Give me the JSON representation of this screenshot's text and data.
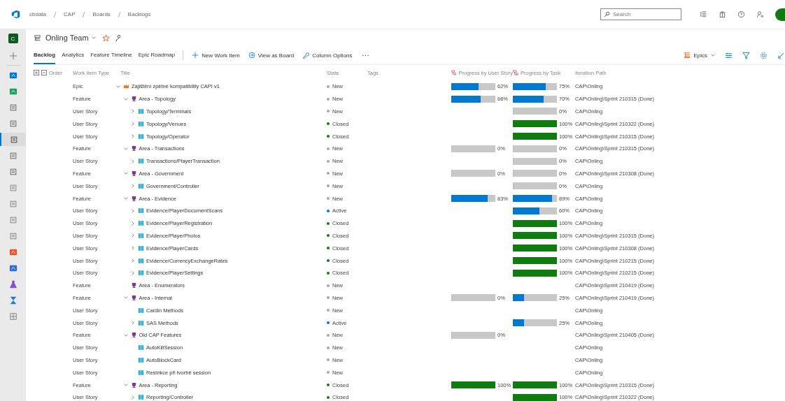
{
  "breadcrumbs": [
    "cbdata",
    "CAP",
    "Boards",
    "Backlogs"
  ],
  "search": {
    "placeholder": "Search"
  },
  "sidebar": {
    "project_initial": "C",
    "items": [
      {
        "kind": "add",
        "selected": false
      },
      {
        "kind": "overview",
        "selected": false
      },
      {
        "kind": "boards",
        "selected": false
      },
      {
        "kind": "workitems",
        "selected": false
      },
      {
        "kind": "board",
        "selected": false
      },
      {
        "kind": "backlog",
        "selected": true
      },
      {
        "kind": "sprints",
        "selected": false
      },
      {
        "kind": "queries",
        "selected": false
      },
      {
        "kind": "list",
        "selected": false
      },
      {
        "kind": "list",
        "selected": false
      },
      {
        "kind": "list",
        "selected": false
      },
      {
        "kind": "card",
        "selected": false
      },
      {
        "kind": "repos",
        "selected": false
      },
      {
        "kind": "pipelines",
        "selected": false
      },
      {
        "kind": "testplans",
        "selected": false
      },
      {
        "kind": "artifacts",
        "selected": false
      },
      {
        "kind": "grid",
        "selected": false
      }
    ]
  },
  "team": {
    "name": "Onling Team"
  },
  "tabs": [
    {
      "label": "Backlog",
      "selected": true
    },
    {
      "label": "Analytics",
      "selected": false
    },
    {
      "label": "Feature Timeline",
      "selected": false
    },
    {
      "label": "Epic Roadmap",
      "selected": false
    }
  ],
  "actions": [
    {
      "kind": "add",
      "label": "New Work Item"
    },
    {
      "kind": "board",
      "label": "View as Board"
    },
    {
      "kind": "wrench",
      "label": "Column Options"
    }
  ],
  "level_picker": {
    "label": "Epics"
  },
  "columns": [
    "Order",
    "Work Item Type",
    "Title",
    "State",
    "Tags",
    "Progress by User Story",
    "Progress by Task",
    "Iteration Path"
  ],
  "items": [
    {
      "kind": "epic",
      "type": "Epic",
      "title": "Zajištění zpětné kompatibility CAPI v1",
      "expanded": true,
      "state": {
        "label": "New",
        "color": "#a6a6a6"
      },
      "story_progress": {
        "level": 0.62,
        "reading": "62%"
      },
      "task_progress": {
        "level": 0.75,
        "reading": "75%"
      },
      "iteration": "CAP\\Onling",
      "children": [
        {
          "kind": "feature",
          "type": "Feature",
          "title": "Area - Topology",
          "expanded": true,
          "state": {
            "label": "New",
            "color": "#a6a6a6"
          },
          "story_progress": {
            "level": 0.66,
            "reading": "66%"
          },
          "task_progress": {
            "level": 0.7,
            "reading": "70%"
          },
          "iteration": "CAP\\Onling\\Sprint 210315 (Done)",
          "children": [
            {
              "kind": "story",
              "type": "User Story",
              "title": "Topology/Terminals",
              "expanded": false,
              "state": {
                "label": "New",
                "color": "#a6a6a6"
              },
              "task_progress": {
                "level": 0,
                "reading": "0%"
              },
              "iteration": "CAP\\Onling"
            },
            {
              "kind": "story",
              "type": "User Story",
              "title": "Topology/Venues",
              "expanded": false,
              "state": {
                "label": "Closed",
                "color": "#107c10"
              },
              "task_progress": {
                "level": 1,
                "reading": "100%"
              },
              "iteration": "CAP\\Onling\\Sprint 210322 (Done)"
            },
            {
              "kind": "story",
              "type": "User Story",
              "title": "Topology/Operator",
              "expanded": false,
              "state": {
                "label": "Closed",
                "color": "#107c10"
              },
              "task_progress": {
                "level": 1,
                "reading": "100%"
              },
              "iteration": "CAP\\Onling\\Sprint 210315 (Done)"
            }
          ]
        },
        {
          "kind": "feature",
          "type": "Feature",
          "title": "Area - Transactions",
          "expanded": true,
          "state": {
            "label": "New",
            "color": "#a6a6a6"
          },
          "story_progress": {
            "level": 0,
            "reading": "0%"
          },
          "task_progress": {
            "level": 0,
            "reading": "0%"
          },
          "iteration": "CAP\\Onling\\Sprint 210315 (Done)",
          "children": [
            {
              "kind": "story",
              "type": "User Story",
              "title": "Transactions/PlayerTransaction",
              "expanded": false,
              "state": {
                "label": "New",
                "color": "#a6a6a6"
              },
              "task_progress": {
                "level": 0,
                "reading": "0%"
              },
              "iteration": "CAP\\Onling"
            }
          ]
        },
        {
          "kind": "feature",
          "type": "Feature",
          "title": "Area - Government",
          "expanded": true,
          "state": {
            "label": "New",
            "color": "#a6a6a6"
          },
          "story_progress": {
            "level": 0,
            "reading": "0%"
          },
          "task_progress": {
            "level": 0,
            "reading": "0%"
          },
          "iteration": "CAP\\Onling\\Sprint 210308 (Done)",
          "children": [
            {
              "kind": "story",
              "type": "User Story",
              "title": "Government/Controller",
              "expanded": false,
              "state": {
                "label": "New",
                "color": "#a6a6a6"
              },
              "task_progress": {
                "level": 0,
                "reading": "0%"
              },
              "iteration": "CAP\\Onling"
            }
          ]
        },
        {
          "kind": "feature",
          "type": "Feature",
          "title": "Area - Evidence",
          "expanded": true,
          "state": {
            "label": "New",
            "color": "#a6a6a6"
          },
          "story_progress": {
            "level": 0.83,
            "reading": "83%"
          },
          "task_progress": {
            "level": 0.89,
            "reading": "89%"
          },
          "iteration": "CAP\\Onling",
          "children": [
            {
              "kind": "story",
              "type": "User Story",
              "title": "Evidence/PlayerDocumentScans",
              "expanded": false,
              "state": {
                "label": "Active",
                "color": "#0078d4"
              },
              "task_progress": {
                "level": 0.6,
                "reading": "60%"
              },
              "iteration": "CAP\\Onling"
            },
            {
              "kind": "story",
              "type": "User Story",
              "title": "Evidence/PlayerRegistration",
              "expanded": false,
              "state": {
                "label": "Closed",
                "color": "#107c10"
              },
              "task_progress": {
                "level": 1,
                "reading": "100%"
              },
              "iteration": "CAP\\Onling"
            },
            {
              "kind": "story",
              "type": "User Story",
              "title": "Evidence/PlayerPhotos",
              "expanded": false,
              "state": {
                "label": "Closed",
                "color": "#107c10"
              },
              "task_progress": {
                "level": 1,
                "reading": "100%"
              },
              "iteration": "CAP\\Onling\\Sprint 210315 (Done)"
            },
            {
              "kind": "story",
              "type": "User Story",
              "title": "Evidence/PlayerCards",
              "expanded": false,
              "state": {
                "label": "Closed",
                "color": "#107c10"
              },
              "task_progress": {
                "level": 1,
                "reading": "100%"
              },
              "iteration": "CAP\\Onling\\Sprint 210308 (Done)"
            },
            {
              "kind": "story",
              "type": "User Story",
              "title": "Evidence/CurrencyExchangeRates",
              "expanded": false,
              "state": {
                "label": "Closed",
                "color": "#107c10"
              },
              "task_progress": {
                "level": 1,
                "reading": "100%"
              },
              "iteration": "CAP\\Onling\\Sprint 210215 (Done)"
            },
            {
              "kind": "story",
              "type": "User Story",
              "title": "Evidence/PlayerSettings",
              "expanded": false,
              "state": {
                "label": "Closed",
                "color": "#107c10"
              },
              "task_progress": {
                "level": 1,
                "reading": "100%"
              },
              "iteration": "CAP\\Onling\\Sprint 210215 (Done)"
            }
          ]
        },
        {
          "kind": "feature",
          "type": "Feature",
          "title": "Area - Enumerators",
          "state": {
            "label": "New",
            "color": "#a6a6a6"
          },
          "iteration": "CAP\\Onling\\Sprint 210419 (Done)"
        },
        {
          "kind": "feature",
          "type": "Feature",
          "title": "Area - Internal",
          "expanded": true,
          "state": {
            "label": "New",
            "color": "#a6a6a6"
          },
          "story_progress": {
            "level": 0,
            "reading": "0%"
          },
          "task_progress": {
            "level": 0.25,
            "reading": "25%"
          },
          "iteration": "CAP\\Onling\\Sprint 210419 (Done)",
          "children": [
            {
              "kind": "story",
              "type": "User Story",
              "title": "Cardin Methods",
              "state": {
                "label": "New",
                "color": "#a6a6a6"
              },
              "iteration": "CAP\\Onling"
            },
            {
              "kind": "story",
              "type": "User Story",
              "title": "SAS Methods",
              "expanded": false,
              "state": {
                "label": "Active",
                "color": "#0078d4"
              },
              "task_progress": {
                "level": 0.25,
                "reading": "25%"
              },
              "iteration": "CAP\\Onling"
            }
          ]
        },
        {
          "kind": "feature",
          "type": "Feature",
          "title": "Old CAP Features",
          "expanded": true,
          "state": {
            "label": "New",
            "color": "#a6a6a6"
          },
          "story_progress": {
            "level": 0,
            "reading": "0%"
          },
          "iteration": "CAP\\Onling\\Sprint 210405 (Done)",
          "children": [
            {
              "kind": "story",
              "type": "User Story",
              "title": "AutoKillSession",
              "state": {
                "label": "New",
                "color": "#a6a6a6"
              },
              "iteration": "CAP\\Onling"
            },
            {
              "kind": "story",
              "type": "User Story",
              "title": "AutoBlockCard",
              "state": {
                "label": "New",
                "color": "#a6a6a6"
              },
              "iteration": "CAP\\Onling"
            },
            {
              "kind": "story",
              "type": "User Story",
              "title": "Restrikce při tvorbě session",
              "state": {
                "label": "New",
                "color": "#a6a6a6"
              },
              "iteration": "CAP\\Onling"
            }
          ]
        },
        {
          "kind": "feature",
          "type": "Feature",
          "title": "Area - Reporting",
          "expanded": true,
          "state": {
            "label": "Closed",
            "color": "#107c10"
          },
          "story_progress": {
            "level": 1,
            "reading": "100%"
          },
          "task_progress": {
            "level": 1,
            "reading": "100%"
          },
          "iteration": "CAP\\Onling\\Sprint 210315 (Done)",
          "children": [
            {
              "kind": "story",
              "type": "User Story",
              "title": "Reporting/Controller",
              "expanded": false,
              "state": {
                "label": "Closed",
                "color": "#107c10"
              },
              "task_progress": {
                "level": 1,
                "reading": "100%"
              },
              "iteration": "CAP\\Onling\\Sprint 210322 (Done)"
            }
          ]
        }
      ]
    }
  ]
}
